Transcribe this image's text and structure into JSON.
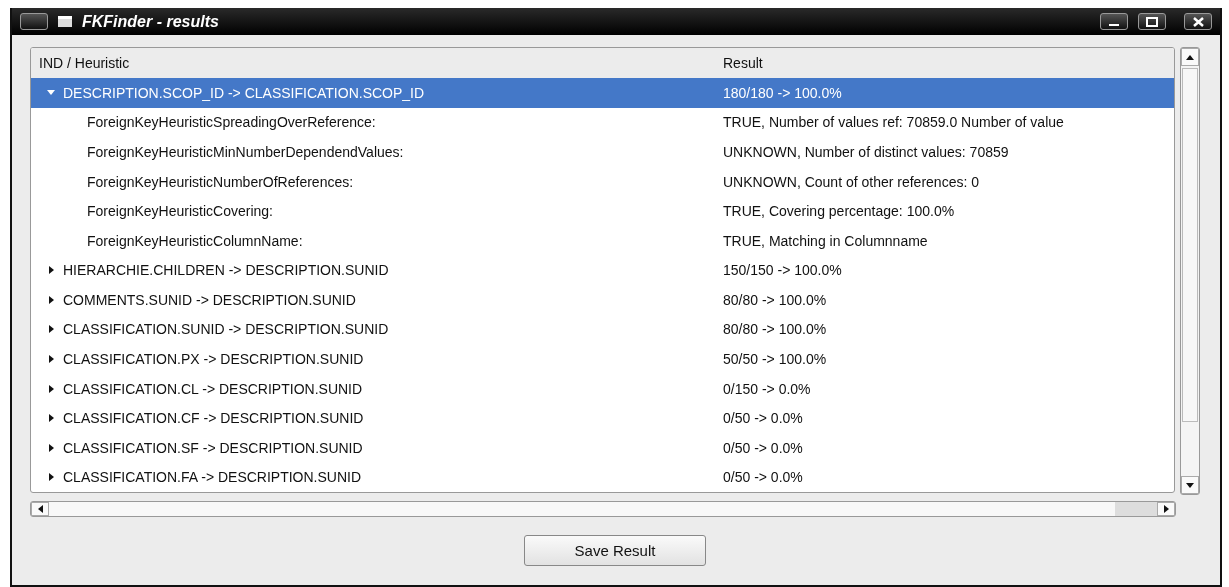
{
  "window": {
    "title": "FKFinder - results"
  },
  "table": {
    "columns": [
      "IND / Heuristic",
      "Result"
    ],
    "rows": [
      {
        "name": "DESCRIPTION.SCOP_ID -> CLASSIFICATION.SCOP_ID",
        "result": "180/180 -> 100.0%",
        "expanded": true,
        "selected": true,
        "children": [
          {
            "name": "ForeignKeyHeuristicSpreadingOverReference:",
            "result": "TRUE, Number of values ref: 70859.0 Number of value"
          },
          {
            "name": "ForeignKeyHeuristicMinNumberDependendValues:",
            "result": "UNKNOWN, Number of distinct values: 70859"
          },
          {
            "name": "ForeignKeyHeuristicNumberOfReferences:",
            "result": "UNKNOWN, Count of other references: 0"
          },
          {
            "name": "ForeignKeyHeuristicCovering:",
            "result": "TRUE, Covering percentage: 100.0%"
          },
          {
            "name": "ForeignKeyHeuristicColumnName:",
            "result": "TRUE, Matching in Columnname"
          }
        ]
      },
      {
        "name": "HIERARCHIE.CHILDREN -> DESCRIPTION.SUNID",
        "result": "150/150 -> 100.0%",
        "expanded": false,
        "selected": false
      },
      {
        "name": "COMMENTS.SUNID -> DESCRIPTION.SUNID",
        "result": "80/80 -> 100.0%",
        "expanded": false,
        "selected": false
      },
      {
        "name": "CLASSIFICATION.SUNID -> DESCRIPTION.SUNID",
        "result": "80/80 -> 100.0%",
        "expanded": false,
        "selected": false
      },
      {
        "name": "CLASSIFICATION.PX -> DESCRIPTION.SUNID",
        "result": "50/50 -> 100.0%",
        "expanded": false,
        "selected": false
      },
      {
        "name": "CLASSIFICATION.CL -> DESCRIPTION.SUNID",
        "result": "0/150 -> 0.0%",
        "expanded": false,
        "selected": false
      },
      {
        "name": "CLASSIFICATION.CF -> DESCRIPTION.SUNID",
        "result": "0/50 -> 0.0%",
        "expanded": false,
        "selected": false
      },
      {
        "name": "CLASSIFICATION.SF -> DESCRIPTION.SUNID",
        "result": "0/50 -> 0.0%",
        "expanded": false,
        "selected": false
      },
      {
        "name": "CLASSIFICATION.FA -> DESCRIPTION.SUNID",
        "result": "0/50 -> 0.0%",
        "expanded": false,
        "selected": false
      }
    ]
  },
  "buttons": [
    "Save Result"
  ]
}
